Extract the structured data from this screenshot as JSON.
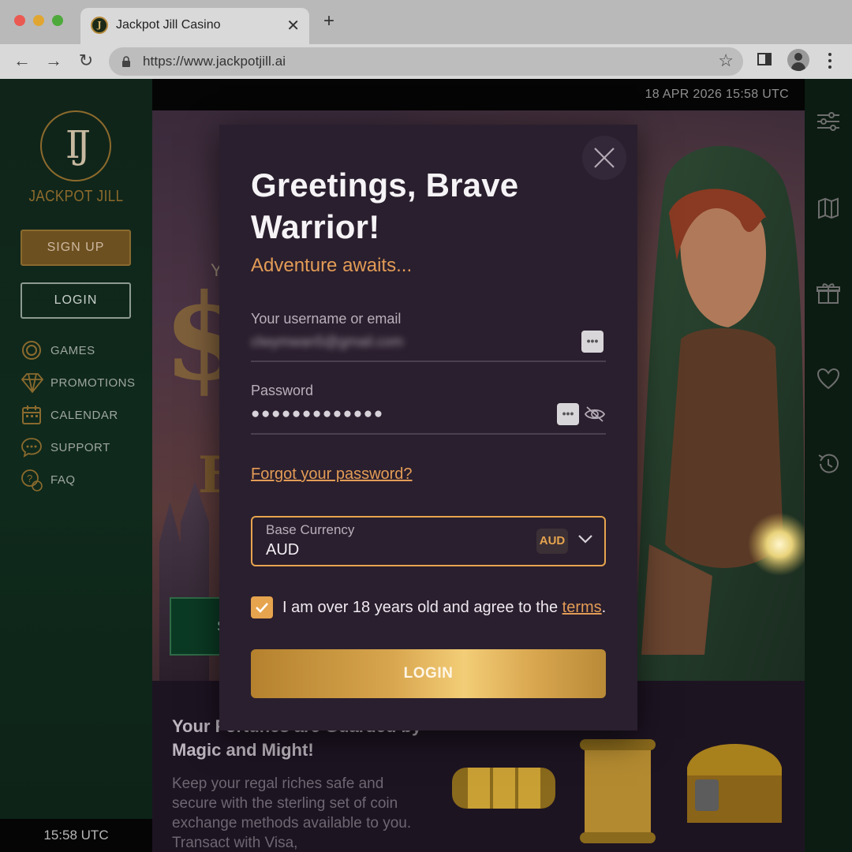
{
  "browser": {
    "tab_title": "Jackpot Jill Casino",
    "favicon_letter": "J",
    "new_tab": "+",
    "tab_close": "✕",
    "url": "https://www.jackpotjill.ai",
    "nav": {
      "back": "←",
      "forward": "→",
      "reload": "↻"
    },
    "bookmark_icon": "☆"
  },
  "sidebar": {
    "logo_glyph": "IJ",
    "logo_text": "JACKPOT JILL",
    "signup_label": "SIGN UP",
    "login_label": "LOGIN",
    "items": [
      {
        "label": "GAMES",
        "icon": "chip-icon"
      },
      {
        "label": "PROMOTIONS",
        "icon": "diamond-icon"
      },
      {
        "label": "CALENDAR",
        "icon": "calendar-icon"
      },
      {
        "label": "SUPPORT",
        "icon": "chat-icon"
      },
      {
        "label": "FAQ",
        "icon": "faq-icon"
      }
    ],
    "clock": "15:58 UTC"
  },
  "header": {
    "datetime": "18 APR 2026 15:58 UTC"
  },
  "right_rail": [
    "filters-icon",
    "map-icon",
    "gift-icon",
    "heart-icon",
    "history-icon"
  ],
  "hero": {
    "letter_y": "Y",
    "dollar": "$",
    "letter_f": "F",
    "cta_letter": "S"
  },
  "lower": {
    "title": "Your Fortunes are Guarded by Magic and Might!",
    "text": "Keep your regal riches safe and secure with the sterling set of coin exchange methods available to you. Transact with Visa,"
  },
  "modal": {
    "title": "Greetings, Brave Warrior!",
    "subtitle": "Adventure awaits...",
    "username_label": "Your username or email",
    "username_value": "clwymwan5@gmail.com",
    "password_label": "Password",
    "password_value": "●●●●●●●●●●●●●",
    "mini_btn": "•••",
    "forgot_label": "Forgot your password?",
    "currency_label": "Base Currency",
    "currency_value": "AUD",
    "currency_badge": "AUD",
    "age_text": "I am over 18 years old and agree to the ",
    "terms_link": "terms",
    "age_text_end": ".",
    "age_checked": true,
    "login_label": "LOGIN"
  },
  "colors": {
    "accent_gold": "#e6a44e",
    "modal_bg": "#2a1f2e",
    "sidebar_green": "#0f2a1c"
  }
}
